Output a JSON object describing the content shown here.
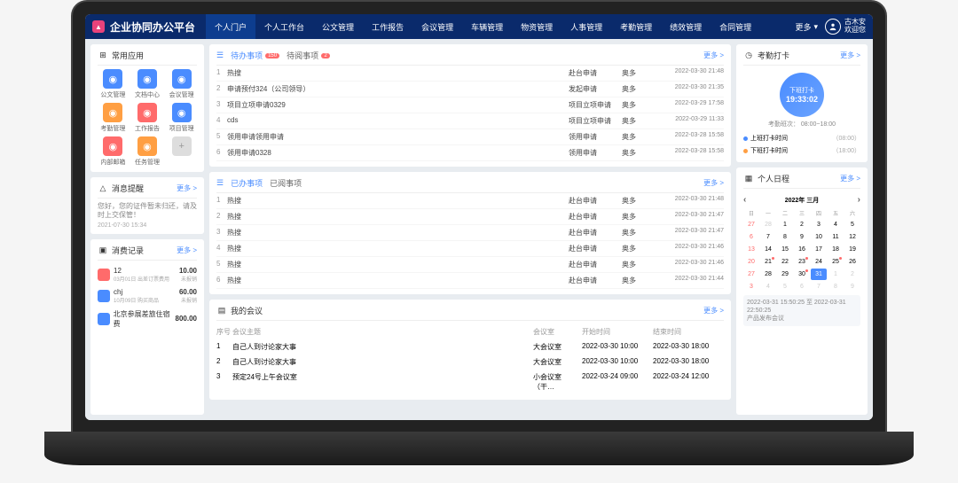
{
  "brand": "企业协同办公平台",
  "nav": [
    "个人门户",
    "个人工作台",
    "公文管理",
    "工作报告",
    "会议管理",
    "车辆管理",
    "物资管理",
    "人事管理",
    "考勤管理",
    "绩效管理",
    "合同管理"
  ],
  "nav_more": "更多",
  "user": {
    "name": "古木安",
    "welcome": "欢迎您"
  },
  "apps": {
    "title": "常用应用",
    "items": [
      {
        "label": "公文管理",
        "color": "bg-b"
      },
      {
        "label": "文档中心",
        "color": "bg-b"
      },
      {
        "label": "会议管理",
        "color": "bg-b"
      },
      {
        "label": "考勤管理",
        "color": "bg-o"
      },
      {
        "label": "工作报告",
        "color": "bg-r"
      },
      {
        "label": "项目管理",
        "color": "bg-b"
      },
      {
        "label": "内部邮箱",
        "color": "bg-r"
      },
      {
        "label": "任务管理",
        "color": "bg-o"
      },
      {
        "label": "+",
        "color": "bg-g"
      }
    ]
  },
  "notice": {
    "title": "消息提醒",
    "more": "更多 >",
    "msg": "您好，您的证件暂未归还，请及时上交保管！",
    "time": "2021-07-30 15:34"
  },
  "expense": {
    "title": "消费记录",
    "more": "更多 >",
    "items": [
      {
        "name": "12",
        "sub": "03月01日  出差订票费用",
        "amt": "10.00",
        "st": "未报销",
        "color": "bg-r"
      },
      {
        "name": "chj",
        "sub": "10月09日  购买商品",
        "amt": "60.00",
        "st": "未报销",
        "color": "bg-b"
      },
      {
        "name": "北京参展差旅住宿费",
        "sub": "",
        "amt": "800.00",
        "st": "",
        "color": "bg-b"
      }
    ]
  },
  "todo": {
    "tabs": [
      {
        "label": "待办事项",
        "badge": "150"
      },
      {
        "label": "待阅事项",
        "badge": "2"
      }
    ],
    "more": "更多 >",
    "rows": [
      {
        "i": "1",
        "t": "热搜",
        "type": "赴台申请",
        "owner": "奥多",
        "time": "2022-03-30 21:48"
      },
      {
        "i": "2",
        "t": "申请预付324（公司领导）",
        "type": "发起申请",
        "owner": "奥多",
        "time": "2022-03-30 21:35"
      },
      {
        "i": "3",
        "t": "项目立项申请0329",
        "type": "项目立项申请",
        "owner": "奥多",
        "time": "2022-03-29 17:58"
      },
      {
        "i": "4",
        "t": "cds",
        "type": "项目立项申请",
        "owner": "奥多",
        "time": "2022-03-29 11:33"
      },
      {
        "i": "5",
        "t": "领用申请领用申请",
        "type": "领用申请",
        "owner": "奥多",
        "time": "2022-03-28 15:58"
      },
      {
        "i": "6",
        "t": "领用申请0328",
        "type": "领用申请",
        "owner": "奥多",
        "time": "2022-03-28 15:58"
      }
    ]
  },
  "done": {
    "tabs": [
      {
        "label": "已办事项"
      },
      {
        "label": "已阅事项"
      }
    ],
    "more": "更多 >",
    "rows": [
      {
        "i": "1",
        "t": "热搜",
        "type": "赴台申请",
        "owner": "奥多",
        "time": "2022-03-30 21:48"
      },
      {
        "i": "2",
        "t": "热搜",
        "type": "赴台申请",
        "owner": "奥多",
        "time": "2022-03-30 21:47"
      },
      {
        "i": "3",
        "t": "热搜",
        "type": "赴台申请",
        "owner": "奥多",
        "time": "2022-03-30 21:47"
      },
      {
        "i": "4",
        "t": "热搜",
        "type": "赴台申请",
        "owner": "奥多",
        "time": "2022-03-30 21:46"
      },
      {
        "i": "5",
        "t": "热搜",
        "type": "赴台申请",
        "owner": "奥多",
        "time": "2022-03-30 21:46"
      },
      {
        "i": "6",
        "t": "热搜",
        "type": "赴台申请",
        "owner": "奥多",
        "time": "2022-03-30 21:44"
      }
    ]
  },
  "meeting": {
    "title": "我的会议",
    "more": "更多 >",
    "headers": [
      "序号",
      "会议主题",
      "会议室",
      "开始时间",
      "结束时间"
    ],
    "rows": [
      {
        "i": "1",
        "t": "自己人到讨论家大事",
        "room": "大会议室",
        "start": "2022-03-30 10:00",
        "end": "2022-03-30 18:00"
      },
      {
        "i": "2",
        "t": "自己人到讨论家大事",
        "room": "大会议室",
        "start": "2022-03-30 10:00",
        "end": "2022-03-30 18:00"
      },
      {
        "i": "3",
        "t": "预定24号上午会议室",
        "room": "小会议室（干…",
        "start": "2022-03-24 09:00",
        "end": "2022-03-24 12:00"
      }
    ]
  },
  "clock": {
    "title": "考勤打卡",
    "more": "更多 >",
    "btn": "下班打卡",
    "time": "19:33:02",
    "schedule": "考勤班次：  08:00~18:00",
    "checkin": "上班打卡时间",
    "checkin_t": "（08:00）",
    "checkout": "下班打卡时间",
    "checkout_t": "（18:00）"
  },
  "calendar": {
    "title": "个人日程",
    "more": "更多 >",
    "month": "2022年 三月",
    "weekdays": [
      "日",
      "一",
      "二",
      "三",
      "四",
      "五",
      "六"
    ],
    "days": [
      {
        "d": "27",
        "c": "out sun"
      },
      {
        "d": "28",
        "c": "out"
      },
      {
        "d": "1",
        "c": ""
      },
      {
        "d": "2",
        "c": ""
      },
      {
        "d": "3",
        "c": ""
      },
      {
        "d": "4",
        "c": ""
      },
      {
        "d": "5",
        "c": ""
      },
      {
        "d": "6",
        "c": "sun"
      },
      {
        "d": "7",
        "c": ""
      },
      {
        "d": "8",
        "c": ""
      },
      {
        "d": "9",
        "c": ""
      },
      {
        "d": "10",
        "c": ""
      },
      {
        "d": "11",
        "c": ""
      },
      {
        "d": "12",
        "c": ""
      },
      {
        "d": "13",
        "c": "sun"
      },
      {
        "d": "14",
        "c": ""
      },
      {
        "d": "15",
        "c": ""
      },
      {
        "d": "16",
        "c": ""
      },
      {
        "d": "17",
        "c": ""
      },
      {
        "d": "18",
        "c": ""
      },
      {
        "d": "19",
        "c": ""
      },
      {
        "d": "20",
        "c": "sun"
      },
      {
        "d": "21",
        "c": "",
        "m": true
      },
      {
        "d": "22",
        "c": ""
      },
      {
        "d": "23",
        "c": "",
        "m": true
      },
      {
        "d": "24",
        "c": ""
      },
      {
        "d": "25",
        "c": "",
        "m": true
      },
      {
        "d": "26",
        "c": ""
      },
      {
        "d": "27",
        "c": "sun"
      },
      {
        "d": "28",
        "c": ""
      },
      {
        "d": "29",
        "c": ""
      },
      {
        "d": "30",
        "c": "",
        "m": true
      },
      {
        "d": "31",
        "c": "today"
      },
      {
        "d": "1",
        "c": "out"
      },
      {
        "d": "2",
        "c": "out"
      },
      {
        "d": "3",
        "c": "out sun"
      },
      {
        "d": "4",
        "c": "out"
      },
      {
        "d": "5",
        "c": "out"
      },
      {
        "d": "6",
        "c": "out"
      },
      {
        "d": "7",
        "c": "out"
      },
      {
        "d": "8",
        "c": "out"
      },
      {
        "d": "9",
        "c": "out"
      }
    ],
    "event": {
      "time": "2022-03-31 15:50:25 至 2022-03-31 22:50:25",
      "title": "产品发布会议"
    }
  }
}
